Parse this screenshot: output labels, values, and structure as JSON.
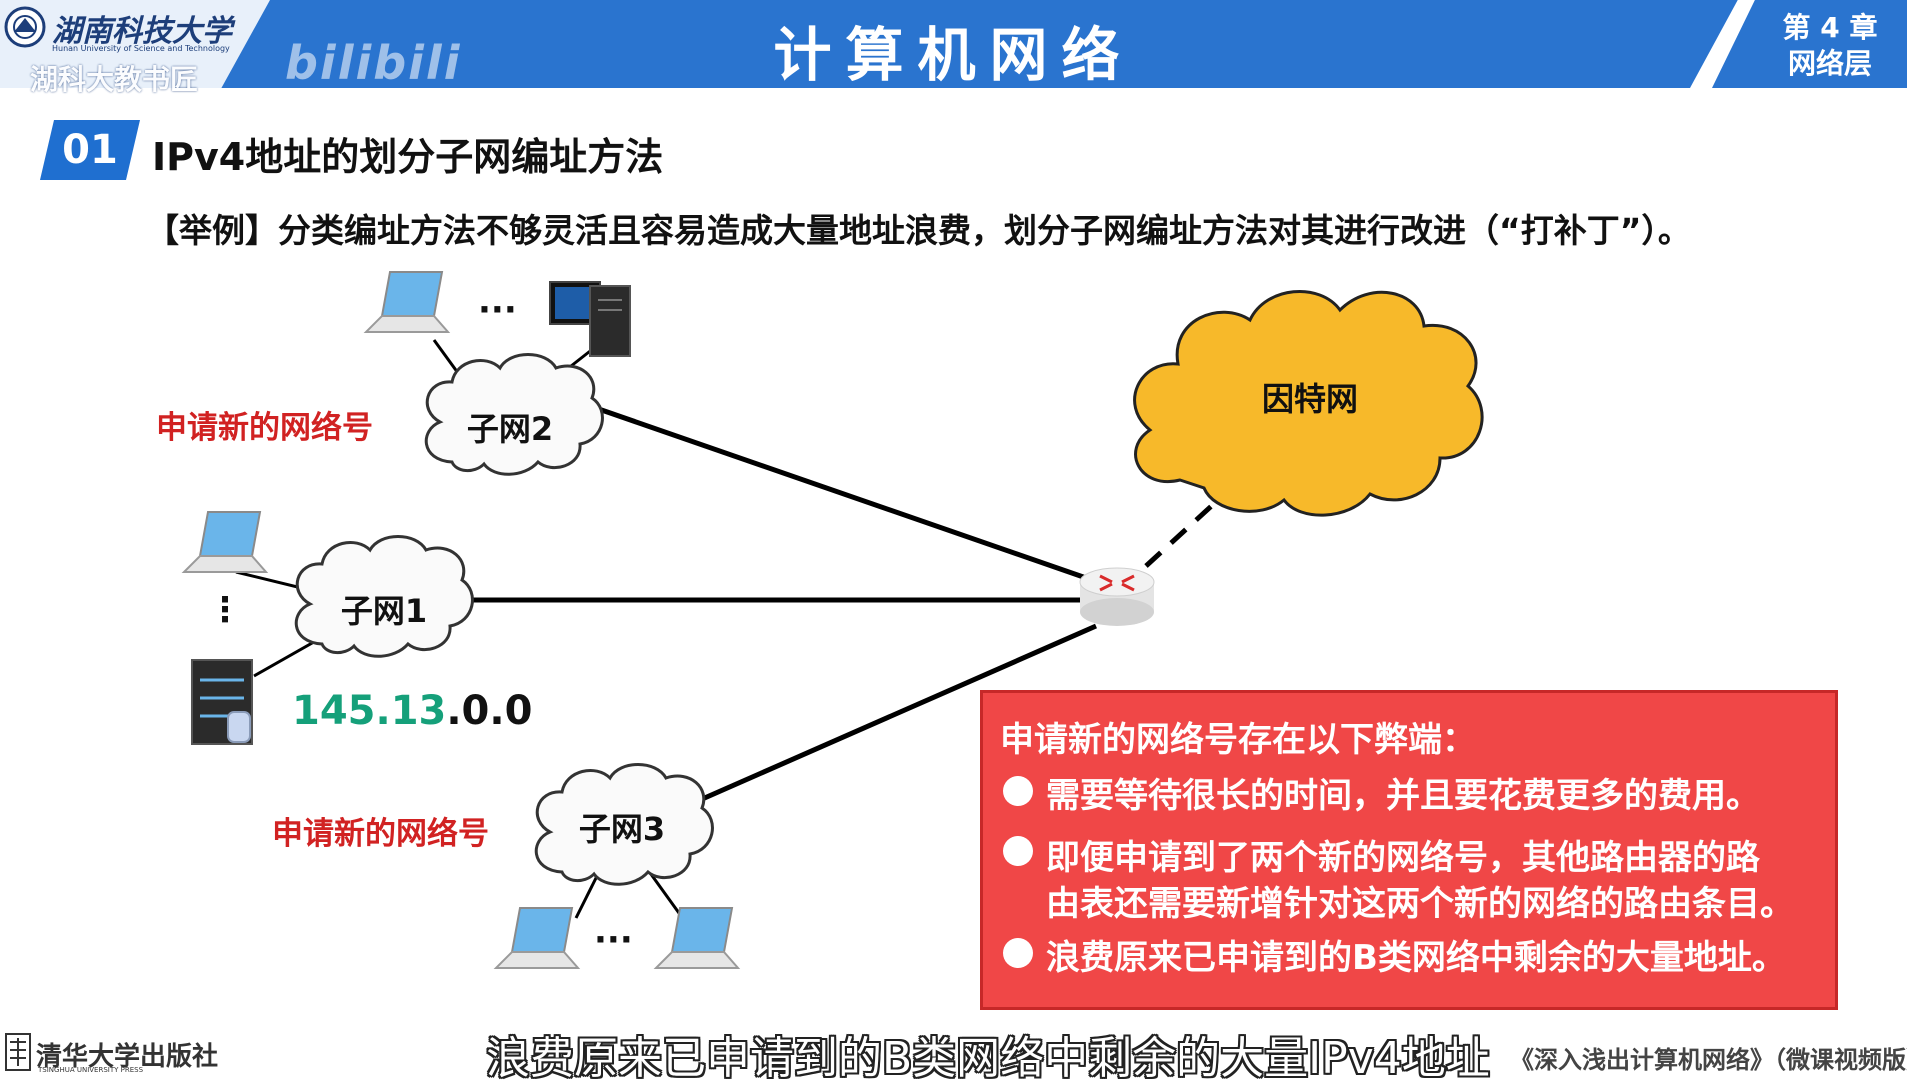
{
  "header": {
    "university_cn": "湖南科技大学",
    "university_en": "Hunan University of Science and Technology",
    "school": "湖科大教书匠",
    "watermark": "bilibili",
    "title": "计算机网络",
    "chapter_line1": "第 4 章",
    "chapter_line2": "网络层"
  },
  "section": {
    "number": "01",
    "title": "IPv4地址的划分子网编址方法"
  },
  "example_text": "【举例】分类编址方法不够灵活且容易造成大量地址浪费，划分子网编址方法对其进行改进（“打补丁”）。",
  "diagram": {
    "internet_label": "因特网",
    "subnet1_label": "子网1",
    "subnet2_label": "子网2",
    "subnet3_label": "子网3",
    "new_network_label_2": "申请新的网络号",
    "new_network_label_3": "申请新的网络号",
    "ip_part1": "145.13",
    "ip_part2": ".0.0",
    "ellipsis_h1": "···",
    "ellipsis_h2": "···",
    "ellipsis_v": "⋮"
  },
  "disadvantages": {
    "title": "申请新的网络号存在以下弊端：",
    "item1": "需要等待很长的时间，并且要花费更多的费用。",
    "item2_line1": "即便申请到了两个新的网络号，其他路由器的路",
    "item2_line2": "由表还需要新增针对这两个新的网络的路由条目。",
    "item3": "浪费原来已申请到的B类网络中剩余的大量地址。"
  },
  "footer": {
    "publisher_cn": "清华大学出版社",
    "publisher_en": "TSINGHUA UNIVERSITY PRESS",
    "subtitle": "浪费原来已申请到的B类网络中剩余的大量IPv4地址",
    "book": "《深入浅出计算机网络》（微课视频版）"
  },
  "colors": {
    "header_blue": "#2a74cf",
    "internet_cloud": "#f7b92a",
    "red_label": "#d12222",
    "ip_green": "#15a07a",
    "box_red": "#f04747"
  }
}
